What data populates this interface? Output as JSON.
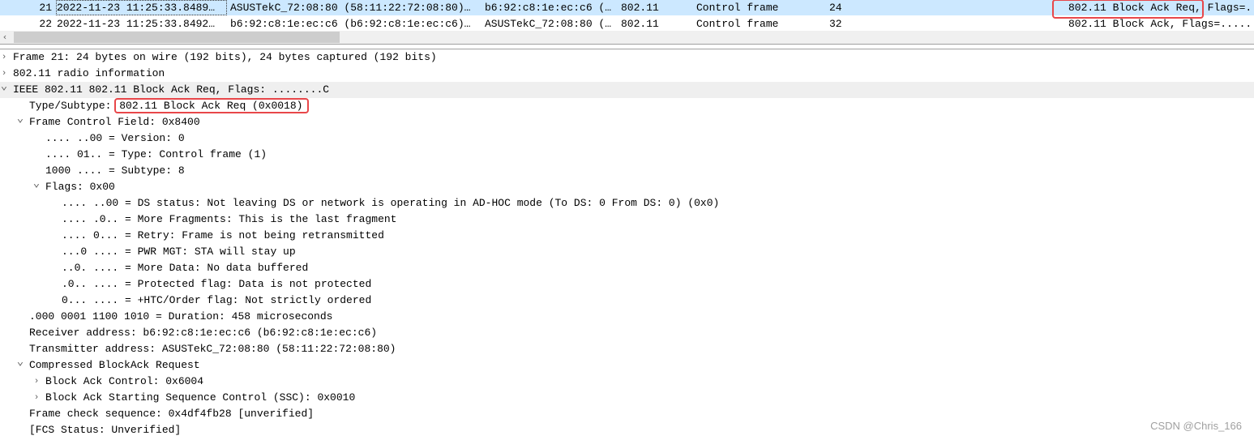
{
  "packet_list": {
    "rows": [
      {
        "no": "21",
        "time": "2022-11-23 11:25:33.8489…",
        "source": "ASUSTekC_72:08:80 (58:11:22:72:08:80)…",
        "destination": "b6:92:c8:1e:ec:c6 (…",
        "protocol": "802.11",
        "type": "Control frame",
        "length": "24",
        "info": "802.11 Block Ack Req, Flags=.",
        "selected": true
      },
      {
        "no": "22",
        "time": "2022-11-23 11:25:33.8492…",
        "source": "b6:92:c8:1e:ec:c6 (b6:92:c8:1e:ec:c6)…",
        "destination": "ASUSTekC_72:08:80 (…",
        "protocol": "802.11",
        "type": "Control frame",
        "length": "32",
        "info": "802.11 Block Ack, Flags=.....",
        "selected": false
      }
    ]
  },
  "scrollbar": {
    "left_arrow": "‹"
  },
  "details": {
    "items": [
      {
        "level": 0,
        "expander": "collapsed",
        "text": "Frame 21: 24 bytes on wire (192 bits), 24 bytes captured (192 bits)"
      },
      {
        "level": 0,
        "expander": "collapsed",
        "text": "802.11 radio information"
      },
      {
        "level": 0,
        "expander": "expanded",
        "text": "IEEE 802.11 802.11 Block Ack Req, Flags: ........C",
        "highlighted": true
      },
      {
        "level": 1,
        "expander": "none",
        "text": "Type/Subtype: ",
        "boxed": "802.11 Block Ack Req (0x0018)"
      },
      {
        "level": 1,
        "expander": "expanded",
        "text": "Frame Control Field: 0x8400"
      },
      {
        "level": 2,
        "expander": "none",
        "text": ".... ..00 = Version: 0"
      },
      {
        "level": 2,
        "expander": "none",
        "text": ".... 01.. = Type: Control frame (1)"
      },
      {
        "level": 2,
        "expander": "none",
        "text": "1000 .... = Subtype: 8"
      },
      {
        "level": 2,
        "expander": "expanded",
        "text": "Flags: 0x00"
      },
      {
        "level": 3,
        "expander": "none",
        "text": ".... ..00 = DS status: Not leaving DS or network is operating in AD-HOC mode (To DS: 0 From DS: 0) (0x0)"
      },
      {
        "level": 3,
        "expander": "none",
        "text": ".... .0.. = More Fragments: This is the last fragment"
      },
      {
        "level": 3,
        "expander": "none",
        "text": ".... 0... = Retry: Frame is not being retransmitted"
      },
      {
        "level": 3,
        "expander": "none",
        "text": "...0 .... = PWR MGT: STA will stay up"
      },
      {
        "level": 3,
        "expander": "none",
        "text": "..0. .... = More Data: No data buffered"
      },
      {
        "level": 3,
        "expander": "none",
        "text": ".0.. .... = Protected flag: Data is not protected"
      },
      {
        "level": 3,
        "expander": "none",
        "text": "0... .... = +HTC/Order flag: Not strictly ordered"
      },
      {
        "level": 1,
        "expander": "none",
        "text": ".000 0001 1100 1010 = Duration: 458 microseconds"
      },
      {
        "level": 1,
        "expander": "none",
        "text": "Receiver address: b6:92:c8:1e:ec:c6 (b6:92:c8:1e:ec:c6)"
      },
      {
        "level": 1,
        "expander": "none",
        "text": "Transmitter address: ASUSTekC_72:08:80 (58:11:22:72:08:80)"
      },
      {
        "level": 1,
        "expander": "expanded",
        "text": "Compressed BlockAck Request"
      },
      {
        "level": 2,
        "expander": "collapsed",
        "text": "Block Ack Control: 0x6004"
      },
      {
        "level": 2,
        "expander": "collapsed",
        "text": "Block Ack Starting Sequence Control (SSC): 0x0010"
      },
      {
        "level": 1,
        "expander": "none",
        "text": "Frame check sequence: 0x4df4fb28 [unverified]"
      },
      {
        "level": 1,
        "expander": "none",
        "text": "[FCS Status: Unverified]"
      }
    ]
  },
  "watermark": "CSDN @Chris_166",
  "colors": {
    "selected_row": "#cce8ff",
    "highlight_box": "#e8474a",
    "expanded_row": "#efefef"
  }
}
